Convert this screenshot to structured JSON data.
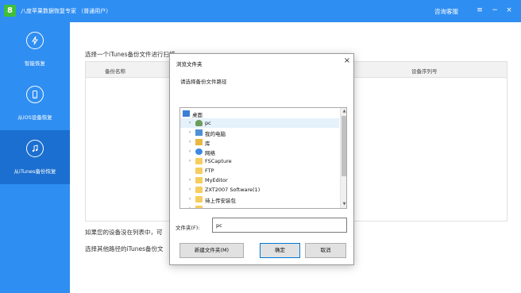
{
  "app": {
    "logo_text": "8",
    "title": "八度苹果数据恢复专家 （普通用户）",
    "support_label": "咨询客服",
    "menu_icon": "menu-icon",
    "minimize_icon": "minimize-icon",
    "close_icon": "close-icon"
  },
  "sidebar": {
    "items": [
      {
        "label": "智能恢复",
        "icon": "smart-recovery-icon",
        "active": false
      },
      {
        "label": "从iOS设备恢复",
        "icon": "phone-icon",
        "active": false
      },
      {
        "label": "从iTunes备份恢复",
        "icon": "music-note-icon",
        "active": true
      }
    ]
  },
  "main": {
    "heading": "选择一个iTunes备份文件进行扫描",
    "columns": [
      "备份名称",
      "设备序列号"
    ],
    "hint": "如果您的设备没在列表中，可",
    "other_path": "选择其他路径的iTunes备份文"
  },
  "dialog": {
    "title": "浏览文件夹",
    "prompt": "请选择备份文件路径",
    "tree": [
      {
        "label": "桌面",
        "icon": "desktop-icon",
        "caret": "",
        "level": 0,
        "selected": false
      },
      {
        "label": "pc",
        "icon": "user-icon",
        "caret": "›",
        "level": 1,
        "selected": true
      },
      {
        "label": "我的电脑",
        "icon": "computer-icon",
        "caret": "›",
        "level": 1,
        "selected": false
      },
      {
        "label": "库",
        "icon": "library-icon",
        "caret": "›",
        "level": 1,
        "selected": false
      },
      {
        "label": "网络",
        "icon": "network-icon",
        "caret": "›",
        "level": 1,
        "selected": false
      },
      {
        "label": "FSCapture",
        "icon": "folder-icon",
        "caret": "›",
        "level": 1,
        "selected": false
      },
      {
        "label": "FTP",
        "icon": "folder-icon",
        "caret": "",
        "level": 1,
        "selected": false
      },
      {
        "label": "MyEditor",
        "icon": "folder-icon",
        "caret": "›",
        "level": 1,
        "selected": false
      },
      {
        "label": "ZXT2007 Software(1)",
        "icon": "folder-icon",
        "caret": "›",
        "level": 1,
        "selected": false
      },
      {
        "label": "待上传安装包",
        "icon": "folder-icon",
        "caret": "›",
        "level": 1,
        "selected": false
      },
      {
        "label": "工具",
        "icon": "folder-icon",
        "caret": "›",
        "level": 1,
        "selected": false
      }
    ],
    "folder_label": "文件夹(F):",
    "folder_value": "pc",
    "new_folder_button": "新建文件夹(M)",
    "ok_button": "确定",
    "cancel_button": "取消"
  },
  "colors": {
    "brand_blue": "#2f8ef2",
    "sidebar_active": "#1b6fd0",
    "logo_green": "#3fbf3a",
    "selection": "#e5f1fb"
  }
}
